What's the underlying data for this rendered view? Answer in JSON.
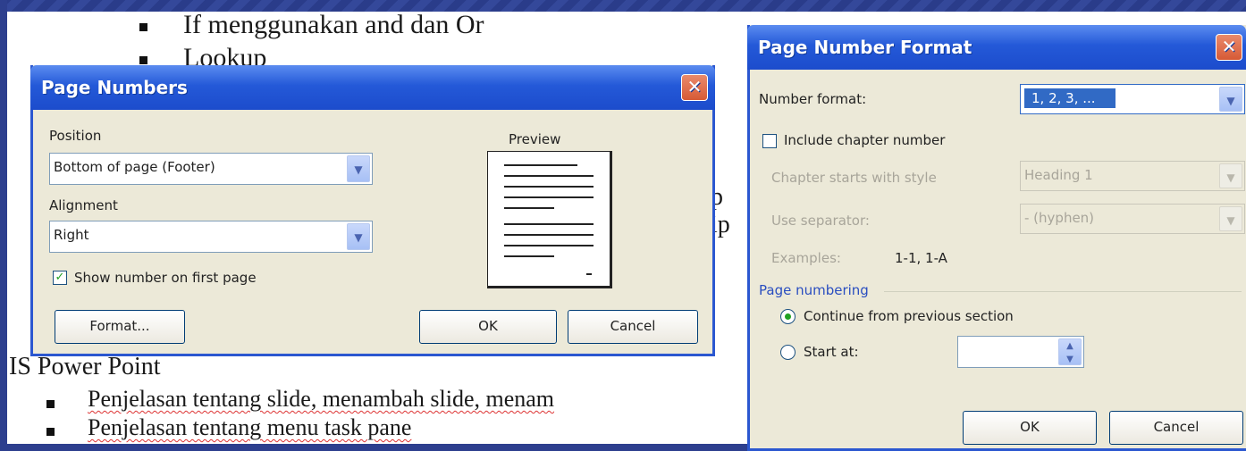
{
  "slide": {
    "line1": "If menggunakan and dan Or",
    "line2": "Lookup",
    "heading": "IS Power Point",
    "bullet1": "Penjelasan tentang slide, menambah slide, menam",
    "bullet2": "Penjelasan tentang menu task pane",
    "frag_p": "p",
    "frag_ip": "ip"
  },
  "page_numbers": {
    "title": "Page Numbers",
    "close": "✕",
    "position_label": "Position",
    "position_value": "Bottom of page (Footer)",
    "alignment_label": "Alignment",
    "alignment_value": "Right",
    "preview_label": "Preview",
    "show_first_label": "Show number on first page",
    "show_first_checked": true,
    "format_button": "Format...",
    "ok_button": "OK",
    "cancel_button": "Cancel"
  },
  "page_number_format": {
    "title": "Page Number Format",
    "close": "✕",
    "number_format_label": "Number format:",
    "number_format_value": "1, 2, 3, ...",
    "include_chapter_label": "Include chapter number",
    "chapter_style_label": "Chapter starts with style",
    "chapter_style_value": "Heading 1",
    "separator_label": "Use separator:",
    "separator_value": "-   (hyphen)",
    "examples_label": "Examples:",
    "examples_value": "1-1, 1-A",
    "page_numbering_label": "Page numbering",
    "continue_label": "Continue from previous section",
    "start_at_label": "Start at:",
    "start_at_value": "",
    "ok_button": "OK",
    "cancel_button": "Cancel"
  },
  "colors": {
    "titlebar": "#2459d8",
    "dialog_bg": "#ece9d8",
    "close": "#d65a35",
    "selection": "#316ac5"
  }
}
